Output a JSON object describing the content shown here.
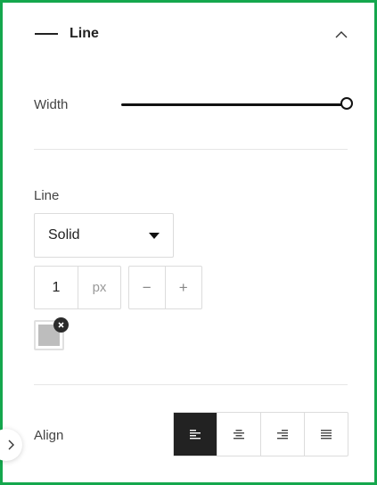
{
  "panel": {
    "title": "Line",
    "icon": "line-icon",
    "collapse_icon": "chevron-up-icon"
  },
  "width_control": {
    "label": "Width",
    "value_fraction": 1.0
  },
  "line_style": {
    "label": "Line",
    "selected": "Solid"
  },
  "thickness": {
    "value": "1",
    "unit": "px",
    "decrement": "−",
    "increment": "+"
  },
  "color": {
    "swatch": "#bdbdbd",
    "clear_icon": "close-icon"
  },
  "align": {
    "label": "Align",
    "options": [
      "align-left-icon",
      "align-center-icon",
      "align-right-icon",
      "align-justify-icon"
    ],
    "active_index": 0
  },
  "colors": {
    "frame_border": "#14a74d",
    "active_bg": "#222222"
  }
}
